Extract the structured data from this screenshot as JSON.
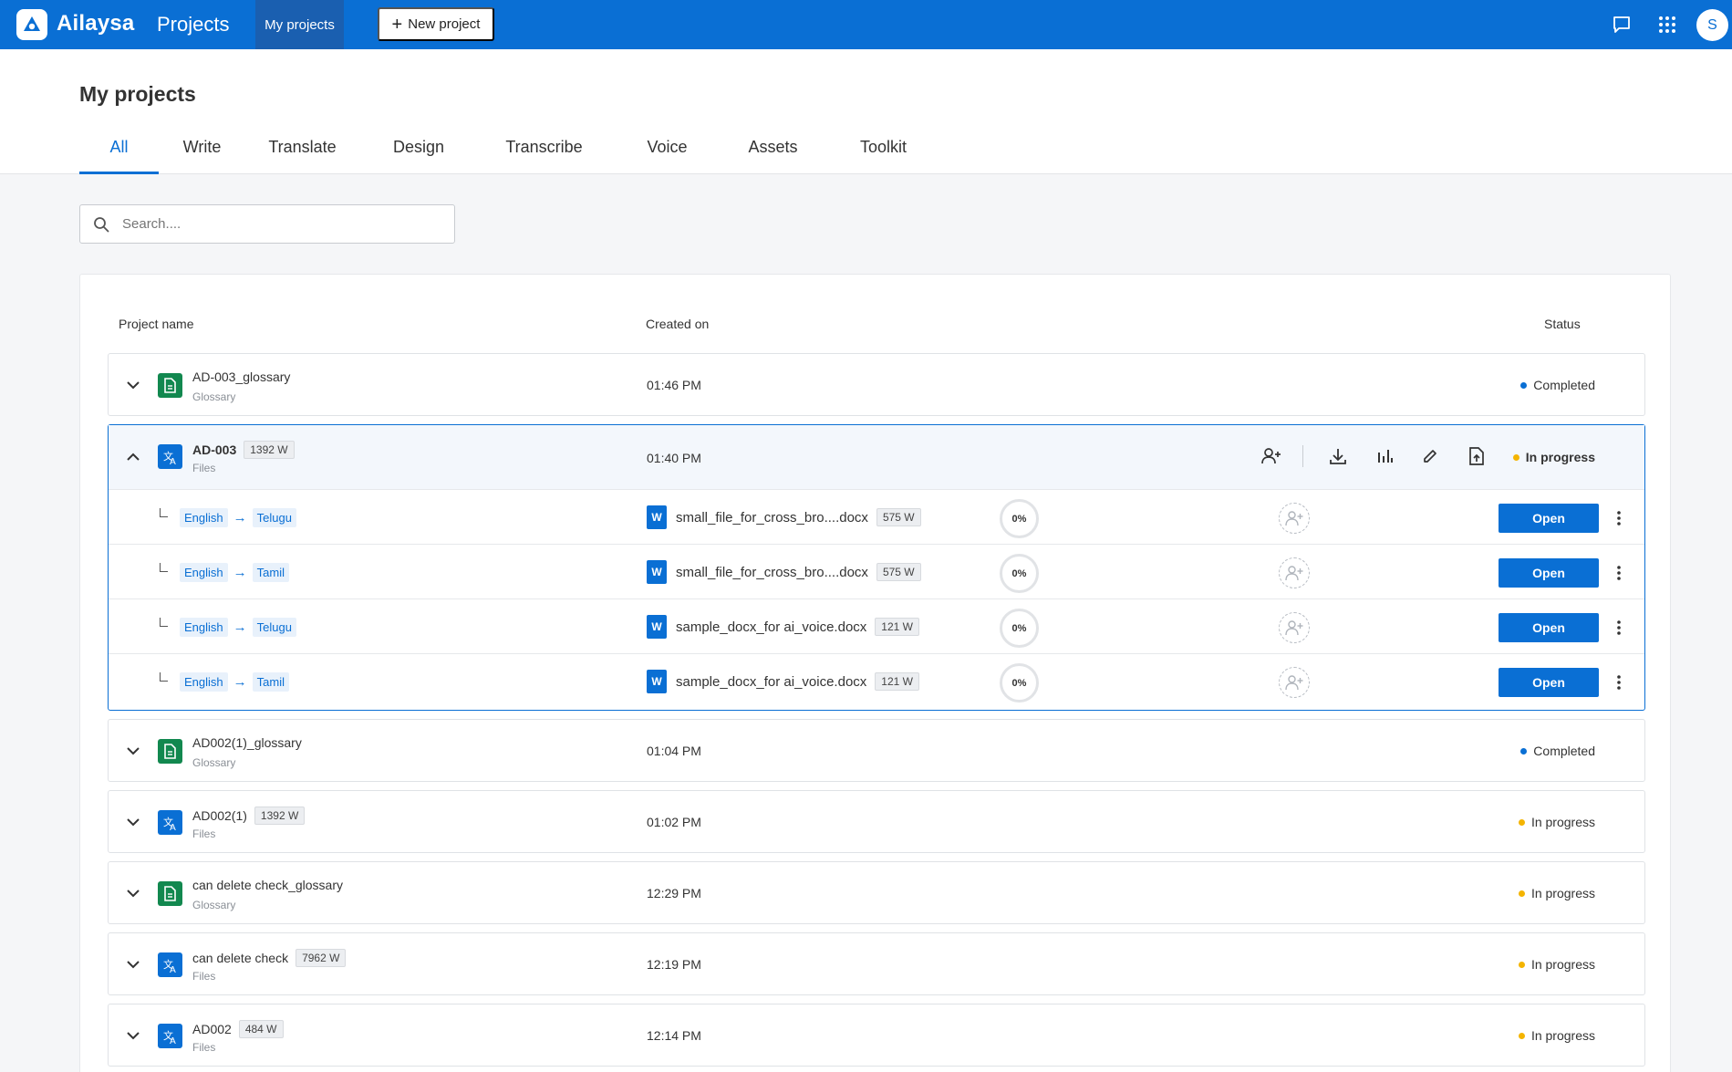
{
  "app": {
    "brand": "Ailaysa",
    "brand_sub": "Projects",
    "nav_active": "My projects",
    "new_project": "New project",
    "avatar_initial": "S",
    "colors": {
      "primary": "#0a6fd4",
      "glossary": "#12884f",
      "completed": "#0a6fd4",
      "in_progress": "#f4b400"
    }
  },
  "page": {
    "title": "My projects",
    "tabs": [
      "All",
      "Write",
      "Translate",
      "Design",
      "Transcribe",
      "Voice",
      "Assets",
      "Toolkit"
    ],
    "active_tab": "All"
  },
  "search": {
    "placeholder": "Search....",
    "value": ""
  },
  "table": {
    "headers": {
      "name": "Project name",
      "created": "Created on",
      "status": "Status"
    },
    "rows": [
      {
        "name": "AD-003_glossary",
        "type": "Glossary",
        "words": "",
        "created": "01:46 PM",
        "status": "Completed"
      },
      {
        "name": "AD-003",
        "type": "Files",
        "words": "1392 W",
        "created": "01:40 PM",
        "status": "In progress",
        "expanded": true,
        "tasks": [
          {
            "source": "English",
            "target": "Telugu",
            "file": "small_file_for_cross_bro....docx",
            "words": "575 W",
            "progress": "0%",
            "action": "Open",
            "file_icon": "W"
          },
          {
            "source": "English",
            "target": "Tamil",
            "file": "small_file_for_cross_bro....docx",
            "words": "575 W",
            "progress": "0%",
            "action": "Open",
            "file_icon": "W"
          },
          {
            "source": "English",
            "target": "Telugu",
            "file": "sample_docx_for ai_voice.docx",
            "words": "121 W",
            "progress": "0%",
            "action": "Open",
            "file_icon": "W"
          },
          {
            "source": "English",
            "target": "Tamil",
            "file": "sample_docx_for ai_voice.docx",
            "words": "121 W",
            "progress": "0%",
            "action": "Open",
            "file_icon": "W"
          }
        ]
      },
      {
        "name": "AD002(1)_glossary",
        "type": "Glossary",
        "words": "",
        "created": "01:04 PM",
        "status": "Completed"
      },
      {
        "name": "AD002(1)",
        "type": "Files",
        "words": "1392 W",
        "created": "01:02 PM",
        "status": "In progress"
      },
      {
        "name": "can delete check_glossary",
        "type": "Glossary",
        "words": "",
        "created": "12:29 PM",
        "status": "In progress"
      },
      {
        "name": "can delete check",
        "type": "Files",
        "words": "7962 W",
        "created": "12:19 PM",
        "status": "In progress"
      },
      {
        "name": "AD002",
        "type": "Files",
        "words": "484 W",
        "created": "12:14 PM",
        "status": "In progress"
      }
    ]
  }
}
